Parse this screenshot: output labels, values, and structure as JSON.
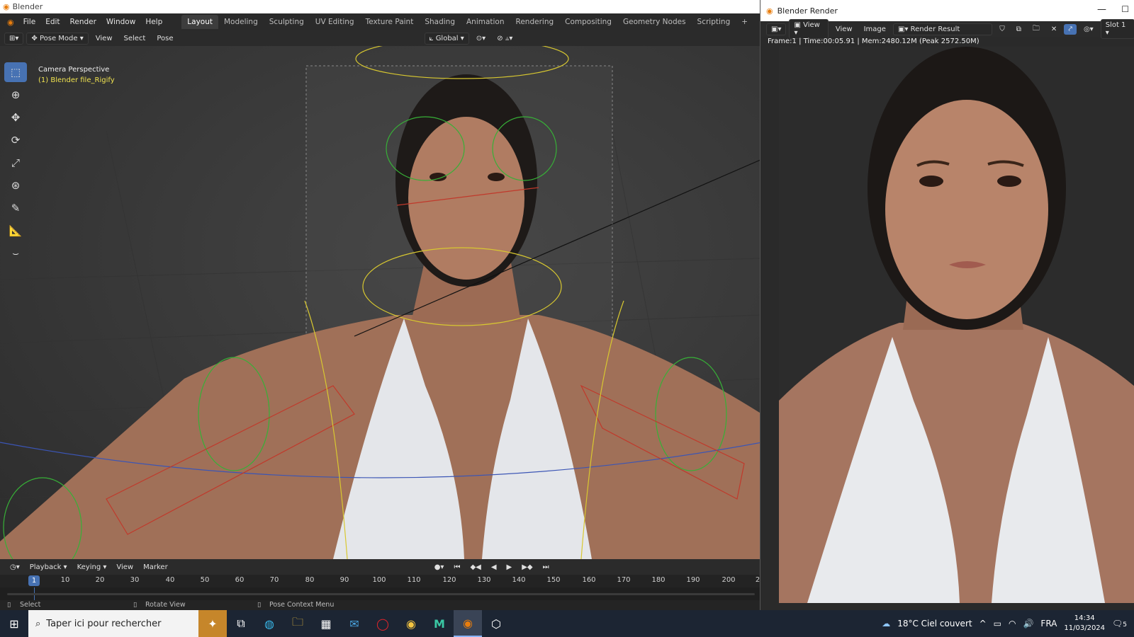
{
  "window": {
    "title": "Blender"
  },
  "menus": [
    "File",
    "Edit",
    "Render",
    "Window",
    "Help"
  ],
  "workspaces": [
    "Layout",
    "Modeling",
    "Sculpting",
    "UV Editing",
    "Texture Paint",
    "Shading",
    "Animation",
    "Rendering",
    "Compositing",
    "Geometry Nodes",
    "Scripting"
  ],
  "viewport_header": {
    "mode": "Pose Mode",
    "items": [
      "View",
      "Select",
      "Pose"
    ],
    "transform": "Global"
  },
  "viewport": {
    "camera_label": "Camera Perspective",
    "object_label": "(1) Blender file_Rigify"
  },
  "timeline": {
    "menus": [
      "Playback",
      "Keying",
      "View",
      "Marker"
    ],
    "current_frame": "1",
    "ticks": [
      "10",
      "20",
      "30",
      "40",
      "50",
      "60",
      "70",
      "80",
      "90",
      "100",
      "110",
      "120",
      "130",
      "140",
      "150",
      "160",
      "170",
      "180",
      "190",
      "200",
      "2"
    ]
  },
  "status_bar": {
    "left": "Select",
    "middle": "Rotate View",
    "right": "Pose Context Menu"
  },
  "render_window": {
    "title": "Blender Render",
    "header": {
      "view": "View",
      "menu_view": "View",
      "menu_image": "Image",
      "result": "Render Result",
      "slot": "Slot 1"
    },
    "info": "Frame:1 | Time:00:05.91 | Mem:2480.12M (Peak 2572.50M)"
  },
  "taskbar": {
    "search_placeholder": "Taper ici pour rechercher",
    "weather": "18°C  Ciel couvert",
    "language": "FRA",
    "time": "14:34",
    "date": "11/03/2024",
    "notifications": "5"
  },
  "icons": [
    "blender-icon",
    "windows-start-icon",
    "search-icon",
    "task-view-icon",
    "edge-icon",
    "file-explorer-icon",
    "store-icon",
    "mail-icon",
    "opera-icon",
    "chrome-icon",
    "m-app-icon",
    "blender-taskbar-icon",
    "box-icon",
    "weather-icon",
    "notification-icon"
  ],
  "colors": {
    "accent": "#4772b3",
    "object_label": "#f0e350",
    "taskbar": "#1c2533"
  }
}
